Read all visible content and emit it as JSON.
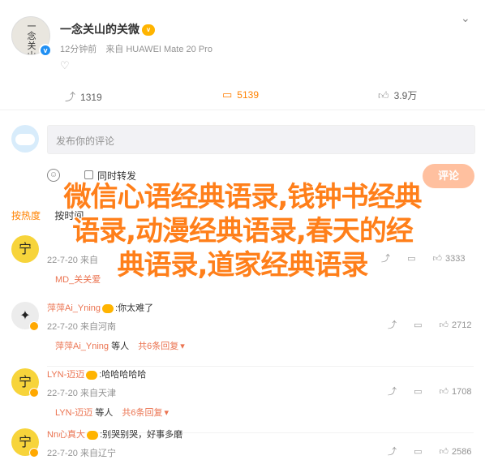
{
  "post": {
    "author": "一念关山的关微",
    "time": "12分钟前",
    "source": "来自 HUAWEI Mate 20 Pro"
  },
  "actions": {
    "share_count": "1319",
    "comment_count": "5139",
    "like_count": "3.9万"
  },
  "compose": {
    "placeholder": "发布你的评论",
    "repost_label": "同时转发",
    "submit_label": "评论"
  },
  "sort": {
    "hot": "按热度",
    "time": "按时间"
  },
  "overlay": {
    "line1": "微信心语经典语录,钱钟书经典",
    "line2": "语录,动漫经典语录,春天的经",
    "line3": "典语录,道家经典语录"
  },
  "comments": [
    {
      "user": "",
      "text": "",
      "time": "22-7-20 来自",
      "likes": "3333",
      "sub_user": "MD_关关爱",
      "sub_text": "",
      "sub_more": ""
    },
    {
      "user": "萍萍Ai_Yning",
      "text": ":你太难了",
      "time": "22-7-20 来自河南",
      "likes": "2712",
      "sub_user": "萍萍Ai_Yning",
      "sub_text": "等人",
      "sub_more": "共6条回复"
    },
    {
      "user": "LYN-迈迈",
      "text": ":哈哈哈哈哈",
      "time": "22-7-20 来自天津",
      "likes": "1708",
      "sub_user": "LYN-迈迈",
      "sub_text": "等人",
      "sub_more": "共6条回复"
    },
    {
      "user": "Nn心真大",
      "text": ":别哭别哭，好事多磨",
      "time": "22-7-20 来自辽宁",
      "likes": "2586",
      "sub_user": "",
      "sub_text": "",
      "sub_more": ""
    }
  ]
}
